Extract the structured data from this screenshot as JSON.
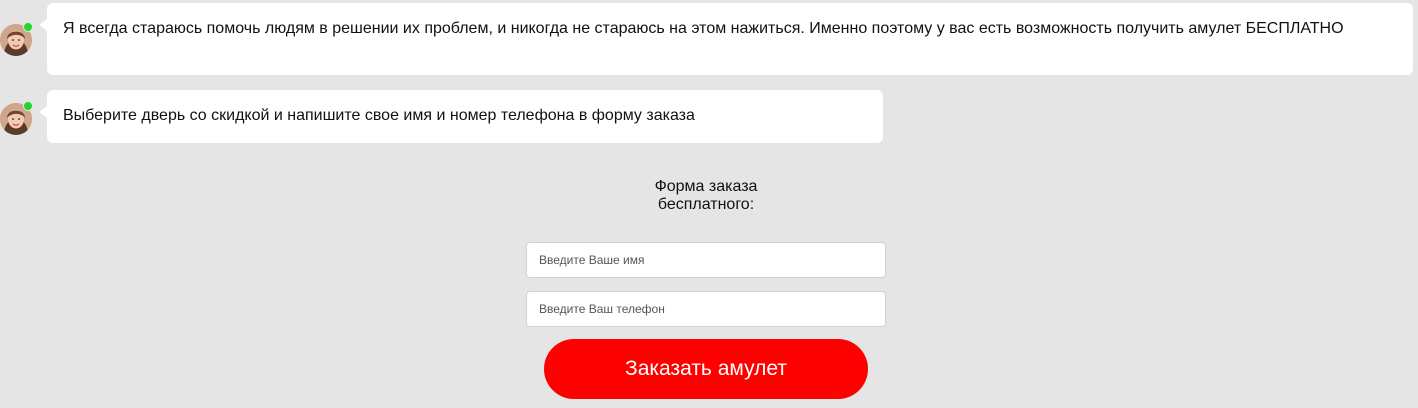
{
  "messages": [
    {
      "text": "Я всегда стараюсь помочь людям в решении их проблем, и никогда не стараюсь на этом нажиться. Именно поэтому у вас есть возможность получить амулет БЕСПЛАТНО"
    },
    {
      "text": "Выберите дверь со скидкой и напишите свое имя и номер телефона в форму заказа"
    }
  ],
  "avatar": {
    "icon": "woman-portrait-icon",
    "status": "online",
    "status_color": "#22d62e"
  },
  "form": {
    "title": "Форма заказа бесплатного:",
    "name_placeholder": "Введите Ваше имя",
    "phone_placeholder": "Введите Ваш телефон",
    "submit_label": "Заказать амулет",
    "accent_color": "#fd0000"
  }
}
